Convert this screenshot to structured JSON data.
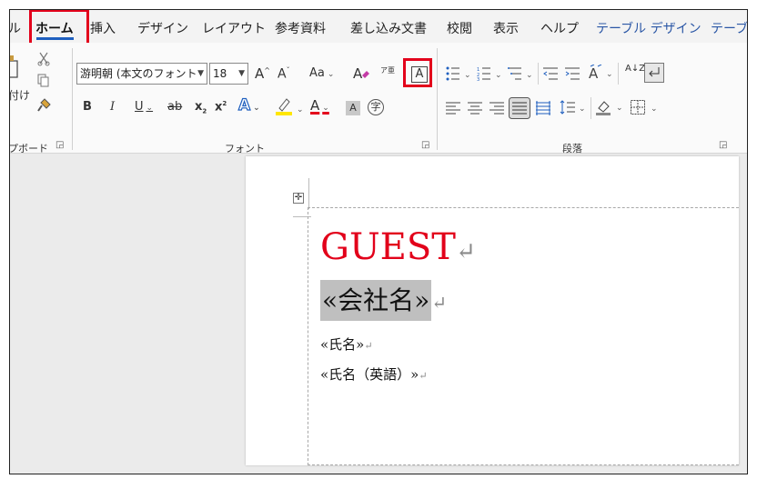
{
  "ribbon_tabs": {
    "cut_off_left": "ル",
    "home": "ホーム",
    "insert": "挿入",
    "design": "デザイン",
    "layout": "レイアウト",
    "references": "参考資料",
    "mailings": "差し込み文書",
    "review": "校閲",
    "view": "表示",
    "help": "ヘルプ",
    "table_design": "テーブル デザイン",
    "cut_off_right": "テーブ"
  },
  "clipboard": {
    "paste_label": "付け",
    "group_label": "プボード"
  },
  "font": {
    "font_name": "游明朝 (本文のフォント",
    "font_size": "18",
    "change_case_label": "Aa",
    "group_label": "フォント",
    "grow_font": "A",
    "shrink_font": "A",
    "bold": "B",
    "italic": "I",
    "underline": "U",
    "strikethrough": "ab",
    "subscript": "x",
    "superscript": "x",
    "effects": "A",
    "font_color": "A",
    "char_shading": "A",
    "enclose_char": "字",
    "char_border": "A",
    "phonetic_guide": "ア亜"
  },
  "paragraph": {
    "group_label": "段落",
    "sort": "A↓Z"
  },
  "document": {
    "guest_text": "GUEST",
    "company_field": "«会社名»",
    "name_field": "«氏名»",
    "name_en_field": "«氏名（英語）»",
    "paragraph_mark": "↵"
  },
  "colors": {
    "highlight_border": "#e3001b",
    "guest_red": "#e2001a",
    "home_underline": "#1f5fbf",
    "field_shading": "#bfbfbf",
    "highlighter_yellow": "#ffe600",
    "font_color_red": "#e3001b"
  }
}
